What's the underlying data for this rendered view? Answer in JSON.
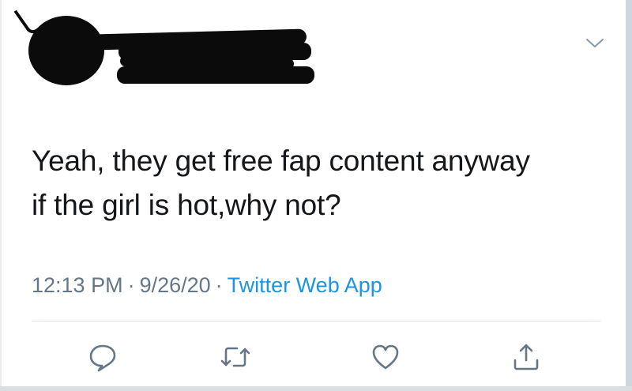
{
  "tweet": {
    "text_lines": [
      "Yeah, they get free fap content anyway",
      "if the girl is hot,why not?"
    ],
    "time": "12:13 PM",
    "separator": "·",
    "date": "9/26/20",
    "source": "Twitter Web App"
  },
  "icons": {
    "more": "chevron-down-icon",
    "reply": "comment-icon",
    "retweet": "retweet-icon",
    "like": "heart-icon",
    "share": "share-icon"
  },
  "colors": {
    "text": "#14171a",
    "meta": "#657786",
    "link": "#1b95e0",
    "icon": "#657786",
    "divider": "#e1e8ed"
  }
}
